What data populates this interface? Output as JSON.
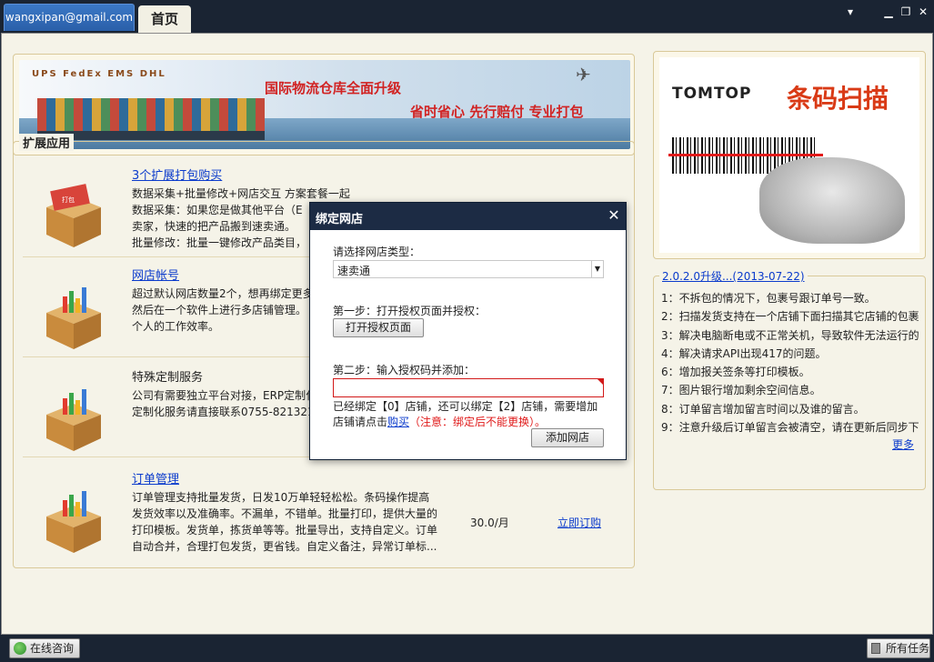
{
  "titlebar": {
    "account": "wangxipan@gmail.com",
    "home_tab": "首页",
    "controls": {
      "menu": "▾",
      "minimize": "▁",
      "restore": "❐",
      "close": "✕"
    }
  },
  "banner": {
    "logos": "UPS FedEx EMS DHL",
    "headline": "国际物流仓库全面升级",
    "tagline": "省时省心  先行赔付  专业打包"
  },
  "apps": {
    "title": "扩展应用",
    "items": [
      {
        "name": "3个扩展打包购买",
        "desc": [
          "数据采集+批量修改+网店交互 方案套餐一起",
          "  数据采集：如果您是做其他平台（E",
          "卖家，快速的把产品搬到速卖通。",
          "  批量修改：批量一键修改产品类目，"
        ],
        "price": "",
        "buy": "",
        "link": true
      },
      {
        "name": "网店帐号",
        "desc": [
          "超过默认网店数量2个，想再绑定更多",
          "然后在一个软件上进行多店铺管理。",
          "个人的工作效率。"
        ],
        "price": "",
        "buy": "",
        "link": true
      },
      {
        "name": "特殊定制服务",
        "desc": [
          "公司有需要独立平台对接，ERP定制化",
          "定制化服务请直接联系0755-821321"
        ],
        "price": "",
        "buy": "",
        "link": false
      },
      {
        "name": "订单管理",
        "desc": [
          "订单管理支持批量发货，日发10万单轻轻松松。条码操作提高",
          "发货效率以及准确率。不漏单，不错单。批量打印，提供大量的",
          "打印模板。发货单，拣货单等等。批量导出，支持自定义。订单",
          "自动合并，合理打包发货，更省钱。自定义备注，异常订单标..."
        ],
        "price": "30.0/月",
        "buy": "立即订购",
        "link": true
      }
    ]
  },
  "ad": {
    "brand": "TOMTOP",
    "slogan": "条码扫描"
  },
  "news": {
    "title": "2.0.2.0升级...(2013-07-22)",
    "items": [
      "1：不拆包的情况下，包裹号跟订单号一致。",
      "2：扫描发货支持在一个店铺下面扫描其它店铺的包裹",
      "3：解决电脑断电或不正常关机，导致软件无法运行的",
      "4：解决请求API出现417的问题。",
      "6：增加报关签条等打印模板。",
      "7：图片银行增加剩余空间信息。",
      "8：订单留言增加留言时间以及谁的留言。",
      "9：注意升级后订单留言会被清空，请在更新后同步下"
    ],
    "more": "更多"
  },
  "dialog": {
    "title": "绑定网店",
    "close": "✕",
    "select_label": "请选择网店类型：",
    "select_value": "速卖通",
    "step1_label": "第一步：打开授权页面并授权：",
    "step1_button": "打开授权页面",
    "step2_label": "第二步：输入授权码并添加：",
    "auth_code": "",
    "info_prefix": "已经绑定【0】店铺，还可以绑定【2】店铺，需要增加店铺请点击",
    "info_link": "购买",
    "info_warn": "（注意：绑定后不能更换）。",
    "add_button": "添加网店"
  },
  "statusbar": {
    "chat": "在线咨询",
    "tasks": "所有任务"
  }
}
